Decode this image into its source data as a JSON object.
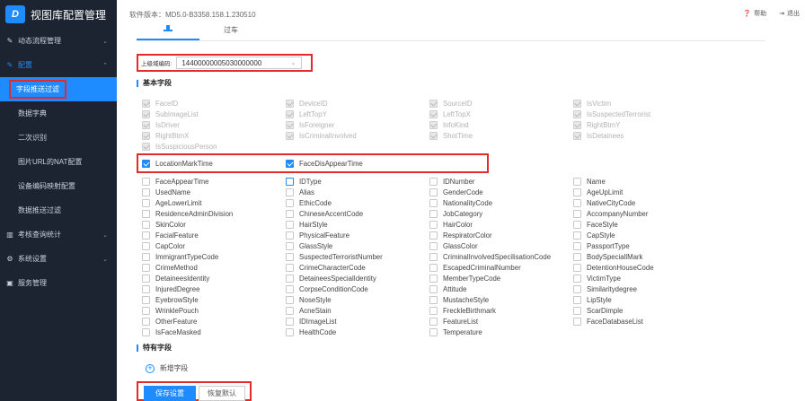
{
  "app": {
    "title": "视图库配置管理",
    "logo_text": "D"
  },
  "header": {
    "version": "软件版本：MD5.0-B3358.158.1.230510",
    "help": "帮助",
    "logout": "退出"
  },
  "sidebar": {
    "items": [
      {
        "label": "动态流程管理",
        "icon": "✎",
        "chevron": "⌄"
      },
      {
        "label": "配置",
        "icon": "✎",
        "chevron": "⌃"
      },
      {
        "label": "字段推送过滤"
      },
      {
        "label": "数据字典"
      },
      {
        "label": "二次识别"
      },
      {
        "label": "图片URL的NAT配置"
      },
      {
        "label": "设备编码映射配置"
      },
      {
        "label": "数据推送过滤"
      },
      {
        "label": "考核查询统计",
        "icon": "▥",
        "chevron": "⌄"
      },
      {
        "label": "系统设置",
        "icon": "⚙",
        "chevron": "⌄"
      },
      {
        "label": "服务管理",
        "icon": "▣"
      }
    ]
  },
  "tabs": [
    {
      "label": "",
      "icon": "person-icon"
    },
    {
      "label": "过车"
    }
  ],
  "code_field": {
    "label": "上级域编码:",
    "value": "14400000005030000000"
  },
  "sections": {
    "basic": "基本字段",
    "special": "特有字段"
  },
  "disabled_fields": [
    "FaceID",
    "DeviceID",
    "SourceID",
    "IsVictim",
    "SubImageList",
    "LeftTopY",
    "LeftTopX",
    "IsSuspectedTerrorist",
    "IsDriver",
    "IsForeigner",
    "InfoKind",
    "RightBtmY",
    "RightBtmX",
    "IsCriminalInvolved",
    "ShotTime",
    "IsDetainees",
    "IsSuspiciousPerson"
  ],
  "checked_fields": [
    "LocationMarkTime",
    "FaceDisAppearTime"
  ],
  "fields": [
    "FaceAppearTime",
    "IDType",
    "IDNumber",
    "Name",
    "UsedName",
    "Alias",
    "GenderCode",
    "AgeUpLimit",
    "AgeLowerLimit",
    "EthicCode",
    "NationalityCode",
    "NativeCityCode",
    "ResidenceAdminDivision",
    "ChineseAccentCode",
    "JobCategory",
    "AccompanyNumber",
    "SkinColor",
    "HairStyle",
    "HairColor",
    "FaceStyle",
    "FacialFeature",
    "PhysicalFeature",
    "RespiratorColor",
    "CapStyle",
    "CapColor",
    "GlassStyle",
    "GlassColor",
    "PassportType",
    "ImmigrantTypeCode",
    "SuspectedTerroristNumber",
    "CriminalInvolvedSpecilisationCode",
    "BodySpeciallMark",
    "CrimeMethod",
    "CrimeCharacterCode",
    "EscapedCriminalNumber",
    "DetentionHouseCode",
    "DetaineesIdentity",
    "DetaineesSpecialIdentity",
    "MemberTypeCode",
    "VictimType",
    "InjuredDegree",
    "CorpseConditionCode",
    "Attitude",
    "Similaritydegree",
    "EyebrowStyle",
    "NoseStyle",
    "MustacheStyle",
    "LipStyle",
    "WrinklePouch",
    "AcneStain",
    "FreckleBirthmark",
    "ScarDimple",
    "OtherFeature",
    "IDImageList",
    "FeatureList",
    "FaceDatabaseList",
    "IsFaceMasked",
    "HealthCode",
    "Temperature"
  ],
  "actions": {
    "add_field": "新增字段",
    "save": "保存设置",
    "reset": "恢复默认"
  },
  "colors": {
    "accent": "#1e8bff",
    "sidebar_bg": "#1c2431",
    "highlight": "#e32b2b"
  }
}
